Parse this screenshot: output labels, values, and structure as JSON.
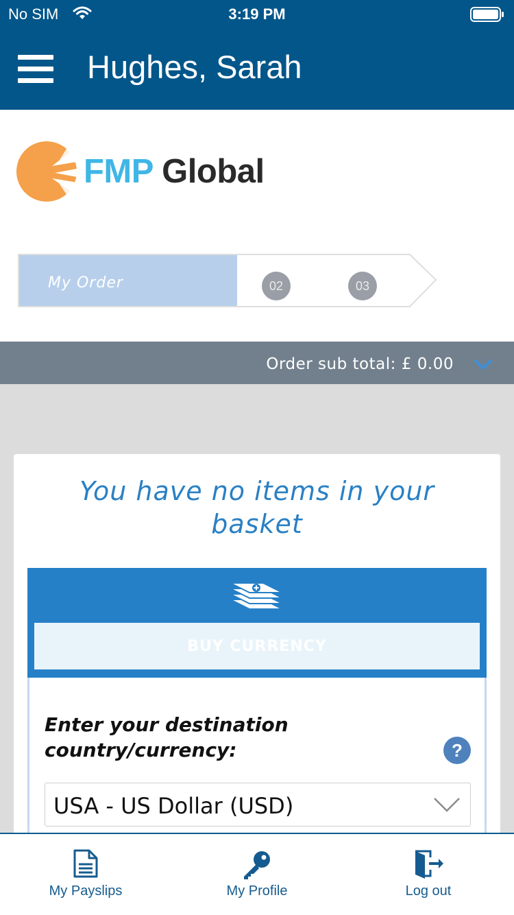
{
  "status_bar": {
    "carrier": "No SIM",
    "time": "3:19 PM"
  },
  "header": {
    "user_name": "Hughes, Sarah"
  },
  "brand": {
    "logo_part1": "FMP",
    "logo_part2": "Global"
  },
  "progress": {
    "steps": [
      {
        "label": "My Order",
        "state": "active"
      },
      {
        "label": "02",
        "state": "pending"
      },
      {
        "label": "03",
        "state": "pending"
      }
    ]
  },
  "order_summary": {
    "label": "Order sub total:",
    "amount": "£ 0.00"
  },
  "basket": {
    "empty_message": "You have no items in your basket"
  },
  "buy": {
    "button_label": "BUY CURRENCY",
    "icon": "money-stack-icon"
  },
  "destination": {
    "label": "Enter your destination country/currency:",
    "help": "?",
    "selected": "USA - US Dollar (USD)"
  },
  "tabs": [
    {
      "label": "My Payslips",
      "icon": "document-icon"
    },
    {
      "label": "My Profile",
      "icon": "key-icon"
    },
    {
      "label": "Log out",
      "icon": "logout-icon"
    }
  ],
  "colors": {
    "header_bg": "#03568a",
    "accent_blue": "#2680c8",
    "message_blue": "#2a80c4",
    "subtotal_bg": "#72808d",
    "step_active": "#b7cfeb",
    "logo_orange": "#f5a04a",
    "logo_cyan": "#3fb6e6"
  }
}
